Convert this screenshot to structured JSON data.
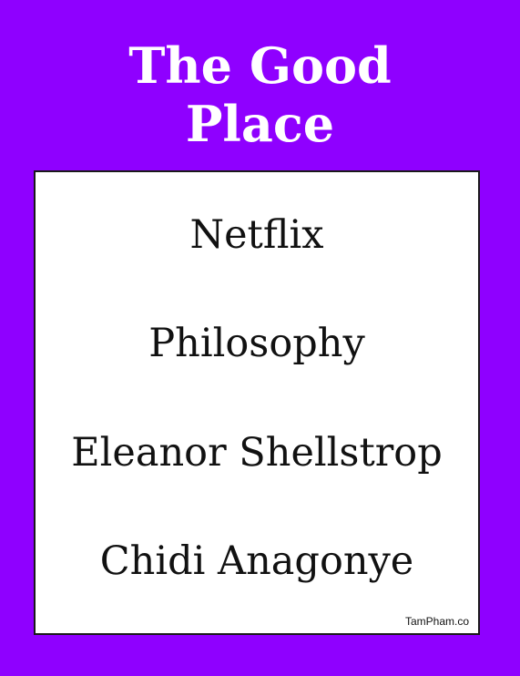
{
  "title": {
    "line1": "The Good",
    "line2": "Place"
  },
  "card": {
    "items": [
      "Netflix",
      "Philosophy",
      "Eleanor Shellstrop",
      "Chidi Anagonye"
    ],
    "credit": "TamPham.co"
  },
  "colors": {
    "background": "#8f00ff",
    "title_text": "#ffffff",
    "card_background": "#ffffff",
    "card_border": "#1a1a1a",
    "item_text": "#111111"
  }
}
